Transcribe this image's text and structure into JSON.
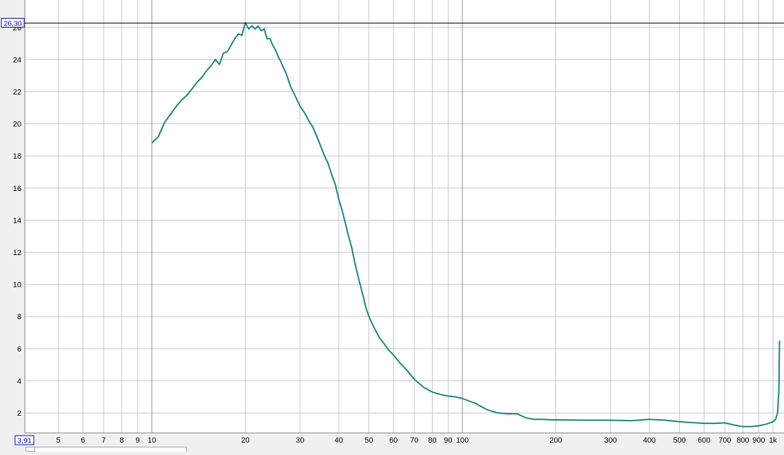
{
  "cursor": {
    "y_readout": "26,30",
    "x_readout": "3,91",
    "y_value": 26.3
  },
  "colors": {
    "curve": "#16857c",
    "grid": "#c4c4c4",
    "grid_major": "#8c8c8c",
    "plot_bg": "#ffffff",
    "cursor_line": "#000000",
    "readout_text": "#0000c0"
  },
  "chart_data": {
    "type": "line",
    "x_scale": "log",
    "xlim": [
      3.91,
      1050
    ],
    "ylim": [
      0.5,
      26.5
    ],
    "grid": true,
    "x_ticks": [
      {
        "v": 5,
        "label": "5"
      },
      {
        "v": 6,
        "label": "6"
      },
      {
        "v": 7,
        "label": "7"
      },
      {
        "v": 8,
        "label": "8"
      },
      {
        "v": 9,
        "label": "9"
      },
      {
        "v": 10,
        "label": "10"
      },
      {
        "v": 20,
        "label": "20"
      },
      {
        "v": 30,
        "label": "30"
      },
      {
        "v": 40,
        "label": "40"
      },
      {
        "v": 50,
        "label": "50"
      },
      {
        "v": 60,
        "label": "60"
      },
      {
        "v": 70,
        "label": "70"
      },
      {
        "v": 80,
        "label": "80"
      },
      {
        "v": 90,
        "label": "90"
      },
      {
        "v": 100,
        "label": "100"
      },
      {
        "v": 200,
        "label": "200"
      },
      {
        "v": 300,
        "label": "300"
      },
      {
        "v": 400,
        "label": "400"
      },
      {
        "v": 500,
        "label": "500"
      },
      {
        "v": 600,
        "label": "600"
      },
      {
        "v": 700,
        "label": "700"
      },
      {
        "v": 800,
        "label": "800"
      },
      {
        "v": 900,
        "label": "900"
      },
      {
        "v": 1000,
        "label": "1k"
      }
    ],
    "y_ticks": [
      {
        "v": 2,
        "label": "2"
      },
      {
        "v": 4,
        "label": "4"
      },
      {
        "v": 6,
        "label": "6"
      },
      {
        "v": 8,
        "label": "8"
      },
      {
        "v": 10,
        "label": "10"
      },
      {
        "v": 12,
        "label": "12"
      },
      {
        "v": 14,
        "label": "14"
      },
      {
        "v": 16,
        "label": "16"
      },
      {
        "v": 18,
        "label": "18"
      },
      {
        "v": 20,
        "label": "20"
      },
      {
        "v": 22,
        "label": "22"
      },
      {
        "v": 24,
        "label": "24"
      },
      {
        "v": 26,
        "label": "26"
      }
    ],
    "series": [
      {
        "x": [
          10,
          10.5,
          11,
          11.5,
          12,
          12.5,
          13,
          13.5,
          14,
          14.5,
          15,
          15.5,
          16,
          16.5,
          17,
          17.5,
          18,
          18.5,
          19,
          19.5,
          20,
          20.5,
          21,
          21.5,
          22,
          22.5,
          23,
          23.5,
          24,
          24.5,
          25,
          25.5,
          26,
          26.5,
          27,
          28,
          29,
          30,
          31,
          32,
          33,
          34,
          35,
          36,
          37,
          38,
          39,
          40,
          41,
          42,
          43,
          44,
          45,
          46,
          47,
          48,
          49,
          50,
          52,
          54,
          56,
          58,
          60,
          63,
          66,
          70,
          75,
          80,
          85,
          90,
          95,
          100,
          110,
          120,
          130,
          140,
          150,
          160,
          170,
          180,
          190,
          200,
          250,
          300,
          350,
          400,
          450,
          500,
          550,
          600,
          650,
          700,
          750,
          800,
          850,
          900,
          950,
          1000,
          1020,
          1035,
          1045,
          1050
        ],
        "y": [
          18.8,
          19.2,
          20.1,
          20.6,
          21.1,
          21.5,
          21.8,
          22.2,
          22.6,
          22.9,
          23.3,
          23.6,
          24.0,
          23.7,
          24.4,
          24.5,
          24.9,
          25.3,
          25.6,
          25.5,
          26.3,
          25.9,
          26.1,
          25.9,
          26.1,
          25.8,
          25.9,
          25.3,
          25.3,
          24.9,
          24.6,
          24.2,
          23.9,
          23.5,
          23.2,
          22.3,
          21.7,
          21.1,
          20.7,
          20.2,
          19.8,
          19.2,
          18.6,
          18.0,
          17.5,
          16.8,
          16.2,
          15.3,
          14.6,
          13.8,
          13.0,
          12.3,
          11.4,
          10.6,
          9.9,
          9.2,
          8.5,
          8.0,
          7.3,
          6.7,
          6.3,
          5.9,
          5.6,
          5.1,
          4.7,
          4.1,
          3.6,
          3.3,
          3.15,
          3.05,
          3.0,
          2.9,
          2.6,
          2.2,
          2.0,
          1.95,
          1.95,
          1.7,
          1.6,
          1.6,
          1.58,
          1.57,
          1.55,
          1.55,
          1.52,
          1.6,
          1.55,
          1.45,
          1.4,
          1.35,
          1.35,
          1.38,
          1.25,
          1.15,
          1.15,
          1.2,
          1.3,
          1.45,
          1.6,
          2.0,
          3.5,
          6.5
        ]
      }
    ]
  }
}
